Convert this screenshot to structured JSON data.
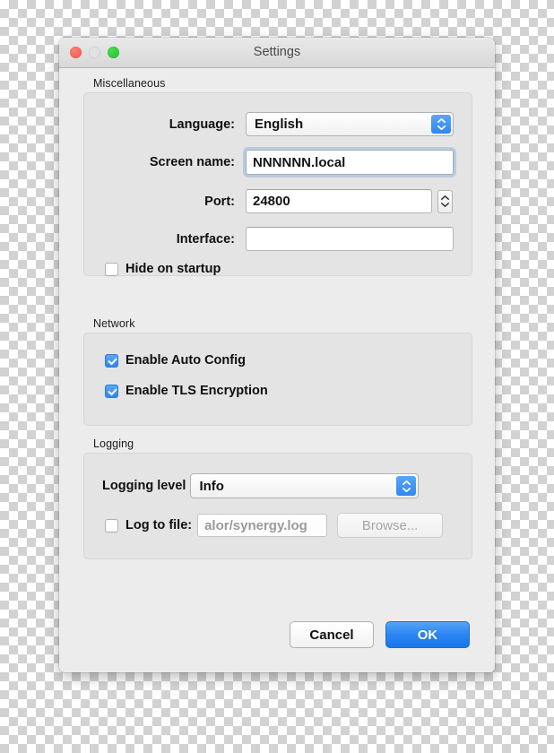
{
  "window": {
    "title": "Settings",
    "traffic_lights": [
      {
        "name": "close",
        "color": "#f2584d"
      },
      {
        "name": "minimize",
        "color": "#e2e2e2"
      },
      {
        "name": "maximize",
        "color": "#21c12e"
      }
    ]
  },
  "accent_colors": {
    "popup_stepper_blue": "#2f88f0",
    "checkbox_blue": "#2f86ef",
    "default_button_blue": "#1877ec"
  },
  "sections": {
    "miscellaneous": {
      "label": "Miscellaneous",
      "language": {
        "label": "Language:",
        "value": "English",
        "options": [
          "English"
        ]
      },
      "screen_name": {
        "label": "Screen name:",
        "value": "NNNNNN.local",
        "placeholder": ""
      },
      "port": {
        "label": "Port:",
        "value": "24800",
        "placeholder": ""
      },
      "interface": {
        "label": "Interface:",
        "value": "",
        "placeholder": ""
      },
      "hide_on_startup": {
        "label": "Hide on startup",
        "checked": false
      }
    },
    "network": {
      "label": "Network",
      "enable_auto_config": {
        "label": "Enable Auto Config",
        "checked": true
      },
      "enable_tls": {
        "label": "Enable TLS Encryption",
        "checked": true
      }
    },
    "logging": {
      "label": "Logging",
      "logging_level": {
        "label": "Logging level",
        "value": "Info",
        "options": [
          "Info"
        ]
      },
      "log_to_file": {
        "label": "Log to file:",
        "checked": false,
        "path_value": "alor/synergy.log",
        "browse_label": "Browse..."
      }
    }
  },
  "footer": {
    "cancel_label": "Cancel",
    "ok_label": "OK"
  }
}
